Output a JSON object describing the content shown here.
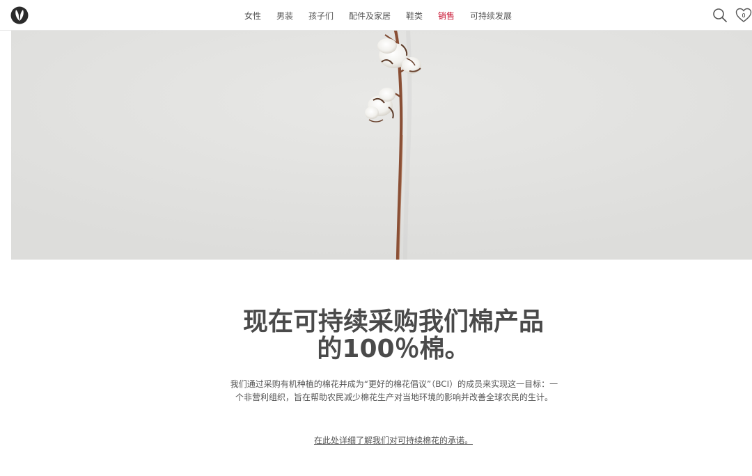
{
  "nav": {
    "items": [
      {
        "label": "女性"
      },
      {
        "label": "男装"
      },
      {
        "label": "孩子们"
      },
      {
        "label": "配件及家居"
      },
      {
        "label": "鞋类"
      },
      {
        "label": "销售"
      },
      {
        "label": "可持续发展"
      }
    ]
  },
  "header": {
    "logo_icon": "leaf-logo-icon",
    "search_icon": "search-icon",
    "wishlist_icon": "heart-icon",
    "wishlist_count": "0"
  },
  "hero": {
    "image": "cotton-branch-photo"
  },
  "main": {
    "headline": "现在可持续采购我们棉产品的100％棉。",
    "body": "我们通过采购有机种植的棉花并成为“更好的棉花倡议”（BCI）的成员来实现这一目标：一个非营利组织，旨在帮助农民减少棉花生产对当地环境的影响并改善全球农民的生计。",
    "link": "在此处详细了解我们对可持续棉花的承诺。"
  },
  "colors": {
    "sale": "#c8102e",
    "text": "#4a4a4a",
    "hero_bg": "#e5e5e3"
  }
}
